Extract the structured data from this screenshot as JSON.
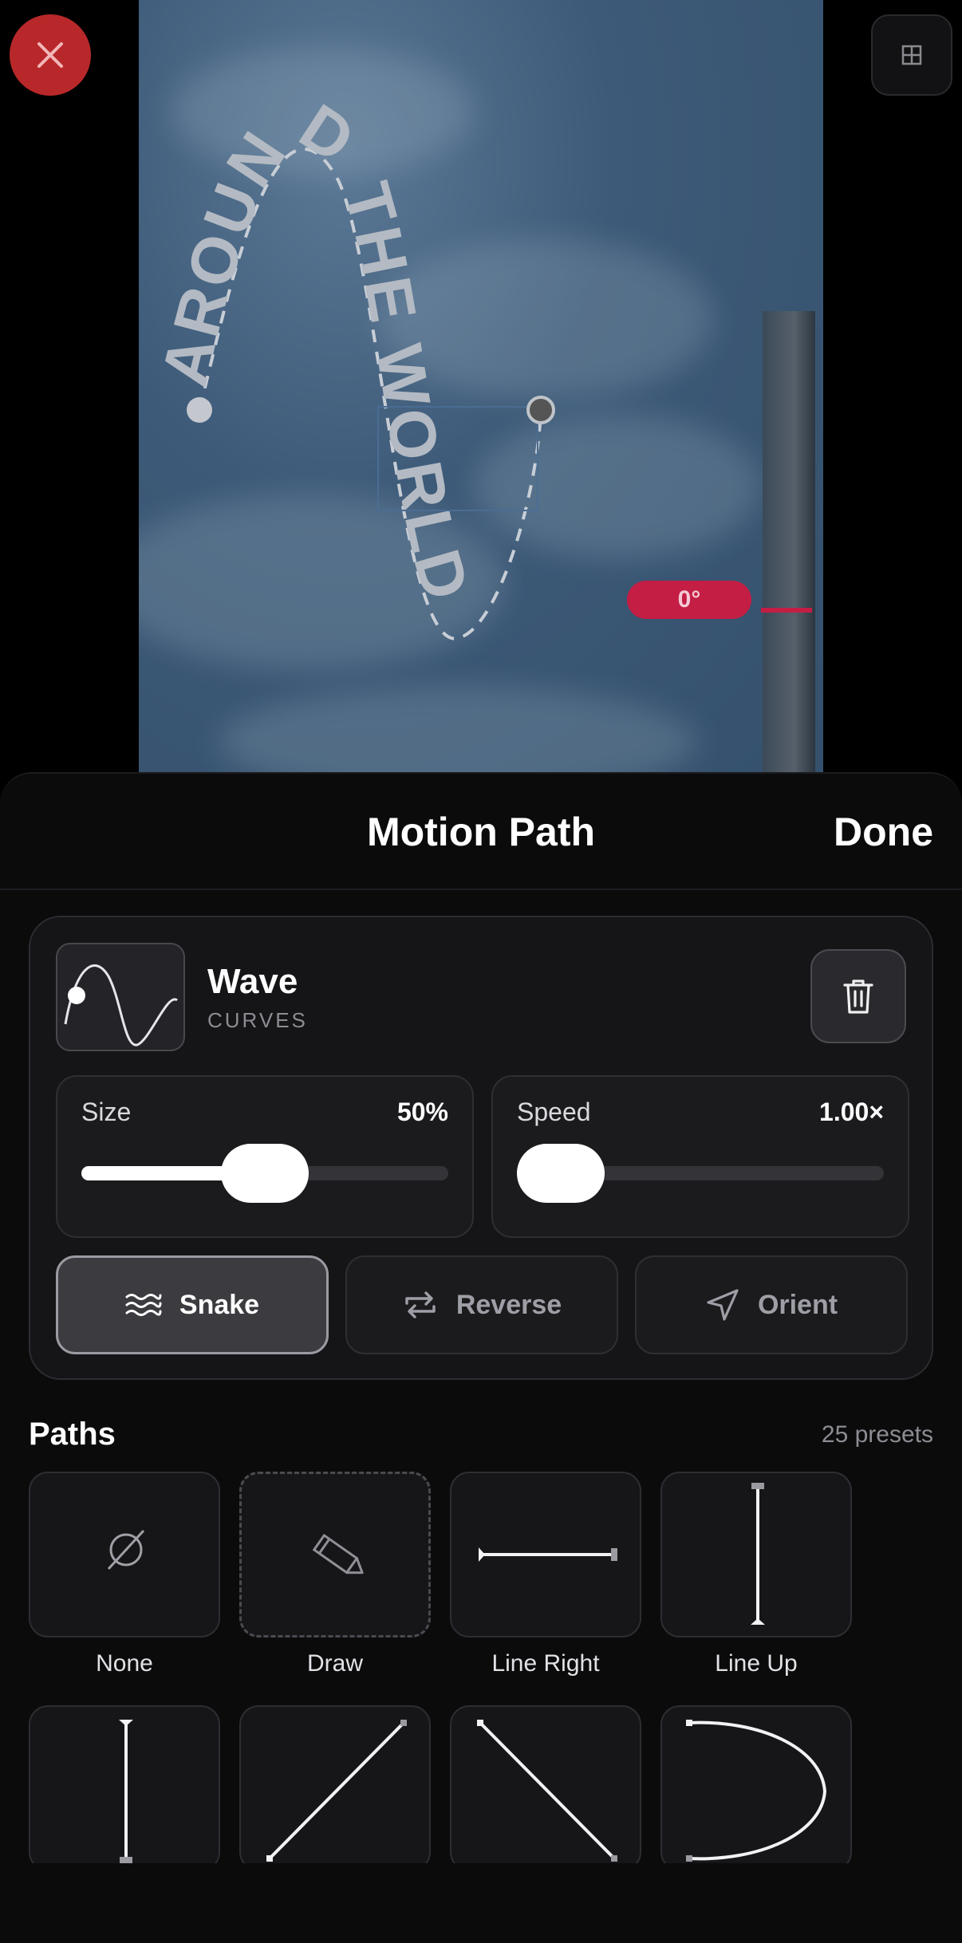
{
  "canvas": {
    "path_text": "AROUND THE WORLD",
    "angle_badge": "0°",
    "close_icon": "close-icon",
    "grid_icon": "grid-icon"
  },
  "sheet": {
    "title": "Motion Path",
    "done_label": "Done"
  },
  "preset": {
    "name": "Wave",
    "category": "CURVES"
  },
  "sliders": {
    "size": {
      "label": "Size",
      "value": "50%",
      "level": 0.5
    },
    "speed": {
      "label": "Speed",
      "value": "1.00×",
      "level": 0.1
    }
  },
  "toggles": [
    {
      "label": "Snake",
      "icon": "waves-icon",
      "active": true
    },
    {
      "label": "Reverse",
      "icon": "repeat-icon",
      "active": false
    },
    {
      "label": "Orient",
      "icon": "navigation-arrow-icon",
      "active": false
    }
  ],
  "paths": {
    "title": "Paths",
    "count": "25 presets",
    "items": [
      {
        "label": "None",
        "icon": "empty-set-icon"
      },
      {
        "label": "Draw",
        "icon": "pencil-icon"
      },
      {
        "label": "Line Right",
        "icon": "line-right-icon"
      },
      {
        "label": "Line Up",
        "icon": "line-up-icon"
      },
      {
        "label": "",
        "icon": "line-down-icon"
      },
      {
        "label": "",
        "icon": "diagonal-up-icon"
      },
      {
        "label": "",
        "icon": "diagonal-down-icon"
      },
      {
        "label": "",
        "icon": "arc-icon"
      }
    ]
  }
}
